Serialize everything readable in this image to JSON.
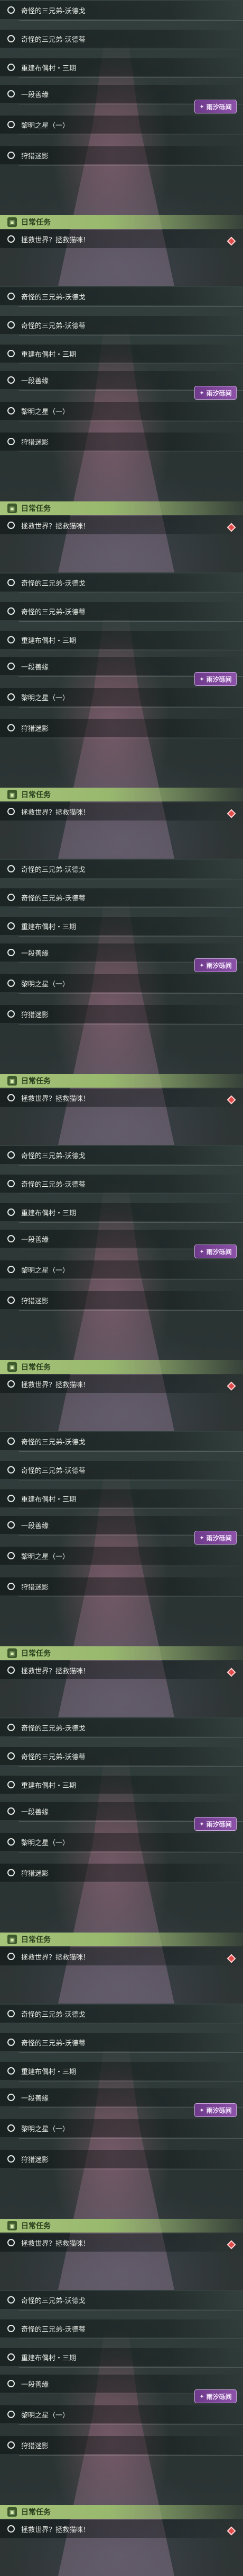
{
  "repeat_count": 9,
  "blocks": [
    {
      "quests": [
        "奇怪的三兄弟-沃德戈",
        "奇怪的三兄弟-沃德蒂",
        "重建布偶村・三期",
        "一段善缘",
        "黎明之星（一）",
        "狩猎迷影"
      ],
      "tag": "雨汐砾间",
      "section_title": "日常任务",
      "daily_quest": "拯救世界？拯救猫咪！"
    },
    {
      "quests": [
        "奇怪的三兄弟-沃德戈",
        "奇怪的三兄弟-沃德蒂",
        "重建布偶村・三期",
        "一段善缘",
        "黎明之星（一）",
        "狩猎迷影"
      ],
      "tag": "雨汐砾间",
      "section_title": "日常任务",
      "daily_quest": "拯救世界？拯救猫咪！"
    },
    {
      "quests": [
        "奇怪的三兄弟-沃德戈",
        "奇怪的三兄弟-沃德蒂",
        "重建布偶村・三期",
        "一段善缘",
        "黎明之星（一）",
        "狩猎迷影"
      ],
      "tag": "雨汐砾间",
      "section_title": "日常任务",
      "daily_quest": "拯救世界？拯救猫咪！"
    },
    {
      "quests": [
        "奇怪的三兄弟-沃德戈",
        "奇怪的三兄弟-沃德蒂",
        "重建布偶村・三期",
        "一段善缘",
        "黎明之星（一）",
        "狩猎迷影"
      ],
      "tag": "雨汐砾间",
      "section_title": "日常任务",
      "daily_quest": "拯救世界？拯救猫咪！"
    },
    {
      "quests": [
        "奇怪的三兄弟-沃德戈",
        "奇怪的三兄弟-沃德蒂",
        "重建布偶村・三期",
        "一段善缘",
        "黎明之星（一）",
        "狩猎迷影"
      ],
      "tag": "雨汐砾间",
      "section_title": "日常任务",
      "daily_quest": "拯救世界？拯救猫咪！"
    },
    {
      "quests": [
        "奇怪的三兄弟-沃德戈",
        "奇怪的三兄弟-沃德蒂",
        "重建布偶村・三期",
        "一段善缘",
        "黎明之星（一）",
        "狩猎迷影"
      ],
      "tag": "雨汐砾间",
      "section_title": "日常任务",
      "daily_quest": "拯救世界？拯救猫咪！"
    },
    {
      "quests": [
        "奇怪的三兄弟-沃德戈",
        "奇怪的三兄弟-沃德蒂",
        "重建布偶村・三期",
        "一段善缘",
        "黎明之星（一）",
        "狩猎迷影"
      ],
      "tag": "雨汐砾间",
      "section_title": "日常任务",
      "daily_quest": "拯救世界？拯救猫咪！"
    },
    {
      "quests": [
        "奇怪的三兄弟-沃德戈",
        "奇怪的三兄弟-沃德蒂",
        "重建布偶村・三期",
        "一段善缘",
        "黎明之星（一）",
        "狩猎迷影"
      ],
      "tag": "雨汐砾间",
      "section_title": "日常任务",
      "daily_quest": "拯救世界？拯救猫咪！"
    },
    {
      "quests": [
        "奇怪的三兄弟-沃德戈",
        "奇怪的三兄弟-沃德蒂",
        "重建布偶村・三期",
        "一段善缘",
        "黎明之星（一）",
        "狩猎迷影"
      ],
      "tag": "雨汐砾间",
      "section_title": "日常任务",
      "daily_quest": "拯救世界？拯救猫咪！"
    }
  ],
  "colors": {
    "ribbon": "#a6c47a",
    "tag": "#8c52a8",
    "gem": "#e04a4a"
  },
  "icons": {
    "section": "daily-task-icon",
    "tag": "region-tag-icon",
    "marker": "red-diamond-marker-icon",
    "quest": "circle-quest-icon"
  }
}
